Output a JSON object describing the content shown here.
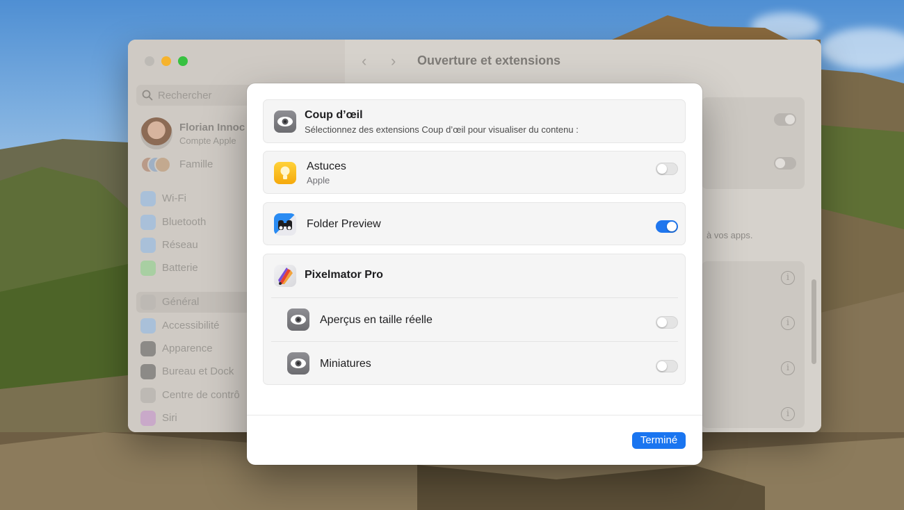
{
  "window": {
    "title": "Ouverture et extensions",
    "traffic_colors": {
      "close": "#bdbab5",
      "minimize": "#f6b32d",
      "maximize": "#37c140"
    }
  },
  "sidebar": {
    "search_placeholder": "Rechercher",
    "account": {
      "name": "Florian Innoc",
      "subtitle": "Compte Apple"
    },
    "family_label": "Famille",
    "items": [
      {
        "label": "Wi-Fi",
        "icon": "wifi-icon",
        "color": "#a9c0d9"
      },
      {
        "label": "Bluetooth",
        "icon": "bluetooth-icon",
        "color": "#a9c0d9"
      },
      {
        "label": "Réseau",
        "icon": "globe-icon",
        "color": "#a9c0d9"
      },
      {
        "label": "Batterie",
        "icon": "battery-icon",
        "color": "#a8cfa2"
      },
      {
        "label": "Général",
        "icon": "gear-icon",
        "color": "#bdb9b4",
        "selected": true
      },
      {
        "label": "Accessibilité",
        "icon": "accessibility-icon",
        "color": "#a9c0d9"
      },
      {
        "label": "Apparence",
        "icon": "appearance-icon",
        "color": "#8c8a87"
      },
      {
        "label": "Bureau et Dock",
        "icon": "dock-icon",
        "color": "#8c8a87"
      },
      {
        "label": "Centre de contrô",
        "icon": "control-center-icon",
        "color": "#bdb9b4"
      },
      {
        "label": "Siri",
        "icon": "siri-icon",
        "color": "#c9a9c9"
      }
    ]
  },
  "background_main": {
    "text_fragment": "à vos apps."
  },
  "modal": {
    "header": {
      "title": "Coup d’œil",
      "subtitle": "Sélectionnez des extensions Coup d’œil pour visualiser du contenu :"
    },
    "extensions": [
      {
        "name": "Astuces",
        "vendor": "Apple",
        "enabled": false,
        "icon": "lightbulb-icon"
      },
      {
        "name": "Folder Preview",
        "enabled": true,
        "icon": "binoculars-icon"
      }
    ],
    "group": {
      "title": "Pixelmator Pro",
      "icon": "pixelmator-icon",
      "items": [
        {
          "name": "Aperçus en taille réelle",
          "enabled": false,
          "icon": "eye-icon"
        },
        {
          "name": "Miniatures",
          "enabled": false,
          "icon": "eye-icon"
        }
      ]
    },
    "done_label": "Terminé",
    "accent": "#1a75f0"
  }
}
